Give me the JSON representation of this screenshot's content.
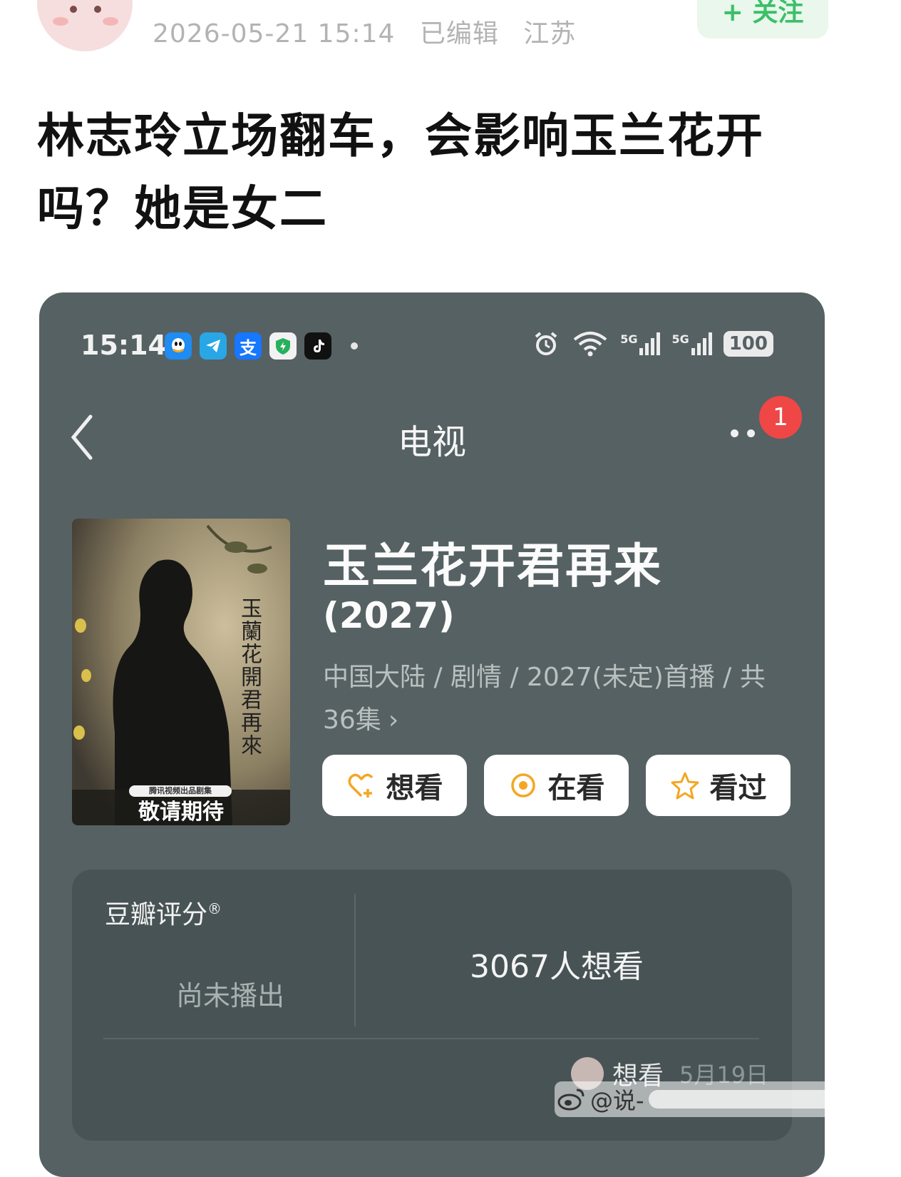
{
  "post": {
    "date": "2026-05-21 15:14",
    "edited": "已编辑",
    "location": "江苏",
    "follow_label": "+ 关注",
    "title": "林志玲立场翻车，会影响玉兰花开吗？她是女二"
  },
  "screenshot": {
    "status_bar": {
      "time": "15:14",
      "app_icons": [
        {
          "name": "qq-icon",
          "glyph": "◉",
          "color": "#1e8cf0"
        },
        {
          "name": "telegram-icon",
          "glyph": "➤",
          "color": "#29a6e6"
        },
        {
          "name": "alipay-icon",
          "glyph": "支",
          "color": "#1677ff"
        },
        {
          "name": "security-shield-icon",
          "glyph": "⚡",
          "color": "#27b05c"
        },
        {
          "name": "tiktok-icon",
          "glyph": "♪",
          "color": "#111111"
        }
      ],
      "network_1": "5G",
      "network_2": "5G",
      "battery": "100"
    },
    "nav": {
      "title": "电视",
      "badge": "1"
    },
    "show": {
      "title": "玉兰花开君再来",
      "year": "(2027)",
      "info": "中国大陆 / 剧情 / 2027(未定)首播 / 共36集",
      "info_arrow": "›",
      "poster": {
        "vertical_title": "玉蘭花開君再來",
        "tag": "腾讯视频出品剧集",
        "slogan": "敬请期待"
      }
    },
    "actions": [
      {
        "label": "想看",
        "icon": "heart-plus-icon"
      },
      {
        "label": "在看",
        "icon": "target-icon"
      },
      {
        "label": "看过",
        "icon": "star-icon"
      }
    ],
    "rating": {
      "label": "豆瓣评分",
      "registered": "®",
      "status": "尚未播出",
      "want_count": "3067人想看",
      "activity_text": "想看",
      "activity_date": "5月19日"
    },
    "colors": {
      "background": "#566163",
      "panel": "#485355",
      "accent_orange": "#f5a623",
      "badge_red": "#ef4646"
    }
  },
  "watermark": {
    "text": "@说-"
  }
}
